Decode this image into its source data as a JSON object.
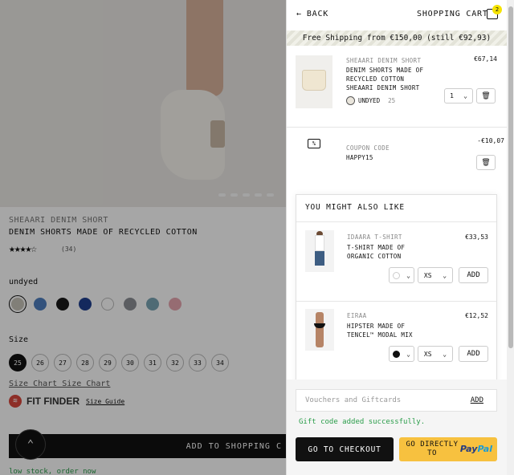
{
  "product": {
    "brand": "SHEAARI DENIM SHORT",
    "title": "DENIM SHORTS MADE OF RECYCLED COTTON",
    "stars": "★★★★☆",
    "review_count": "(34)",
    "color_name": "undyed",
    "swatch_colors": [
      "#c7c3b9",
      "#4f7fbf",
      "#1a1a1a",
      "#1f3f8f",
      "#ffffff",
      "#8c8f96",
      "#7aa5b4",
      "#e6a6b0"
    ],
    "size_label": "Size",
    "sizes": [
      "25",
      "26",
      "27",
      "28",
      "29",
      "30",
      "31",
      "32",
      "33",
      "34"
    ],
    "size_chart": "Size Chart Size Chart",
    "fit_finder": "FIT FINDER",
    "size_guide": "Size Guide",
    "add_to_cart": "ADD TO SHOPPING C",
    "low_stock": "low stock, order now"
  },
  "cart": {
    "back_label": "BACK",
    "title": "SHOPPING CART",
    "badge_count": "2",
    "free_shipping": "Free Shipping from €150,00 (still €92,93)",
    "items": [
      {
        "brand": "SHEAARI DENIM SHORT",
        "name": "DENIM SHORTS MADE OF RECYCLED COTTON SHEAARI DENIM SHORT",
        "price": "€67,14",
        "color": "UNDYED",
        "size": "25",
        "qty": "1"
      }
    ],
    "coupon": {
      "label": "COUPON CODE",
      "code": "HAPPY15",
      "amount": "-€10,07"
    },
    "recommendations": {
      "title": "YOU MIGHT ALSO LIKE",
      "items": [
        {
          "brand": "IDAARA T-SHIRT",
          "name": "T-SHIRT MADE OF ORGANIC COTTON",
          "price": "€33,53",
          "size": "XS",
          "add": "ADD",
          "color": "#ffffff"
        },
        {
          "brand": "EIRAA",
          "name": "HIPSTER MADE OF TENCEL™ MODAL MIX",
          "price": "€12,52",
          "size": "XS",
          "add": "ADD",
          "color": "#111111"
        }
      ]
    },
    "voucher_placeholder": "Vouchers and Giftcards",
    "voucher_add": "ADD",
    "voucher_message": "Gift code added successfully.",
    "checkout_label": "GO TO CHECKOUT",
    "paypal_label": "GO DIRECTLY TO",
    "paypal_logo_a": "Pay",
    "paypal_logo_b": "Pal"
  }
}
